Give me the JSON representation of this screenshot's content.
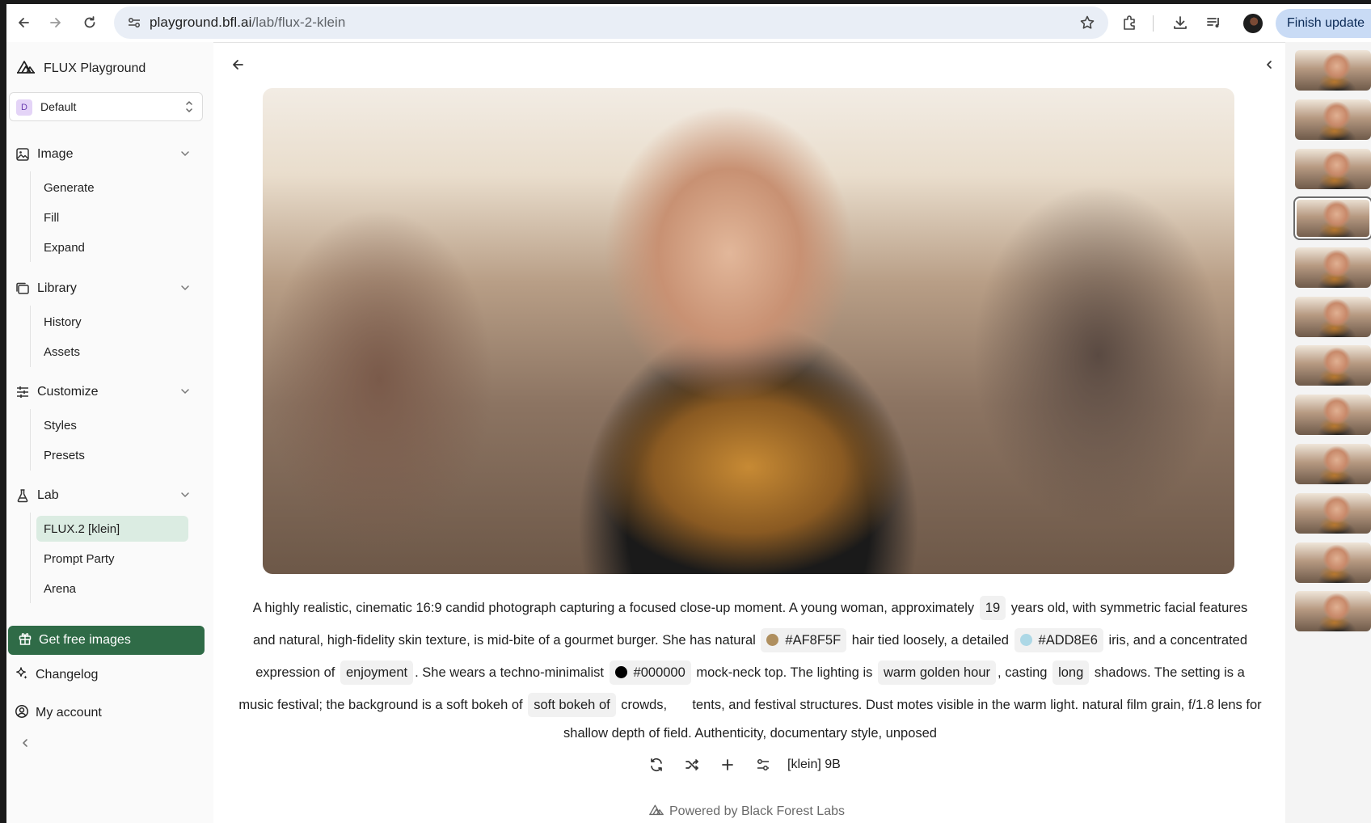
{
  "browser": {
    "url_host": "playground.bfl.ai",
    "url_path": "/lab/flux-2-klein",
    "finish_update_label": "Finish update"
  },
  "sidebar": {
    "brand": "FLUX Playground",
    "workspace": {
      "badge": "D",
      "name": "Default"
    },
    "sections": [
      {
        "label": "Image",
        "items": [
          "Generate",
          "Fill",
          "Expand"
        ]
      },
      {
        "label": "Library",
        "items": [
          "History",
          "Assets"
        ]
      },
      {
        "label": "Customize",
        "items": [
          "Styles",
          "Presets"
        ]
      },
      {
        "label": "Lab",
        "items": [
          "FLUX.2 [klein]",
          "Prompt Party",
          "Arena"
        ],
        "active_item": "FLUX.2 [klein]"
      }
    ],
    "get_free_images": "Get free images",
    "changelog": "Changelog",
    "my_account": "My account"
  },
  "prompt": {
    "line1_a": "A highly realistic, cinematic 16:9 candid photograph capturing a focused close-up moment. A young woman, approximately",
    "age": "19",
    "line1_b": "years old, with symmetric facial features",
    "line2_a": "and natural, high-fidelity skin texture, is mid-bite of a gourmet burger. She has natural",
    "hair_color": "#AF8F5F",
    "line2_b": "hair tied loosely, a detailed",
    "iris_color": "#ADD8E6",
    "line2_c": "iris, and a concentrated",
    "line3_a": "expression of",
    "expression": "enjoyment",
    "line3_b": ". She wears a techno-minimalist",
    "top_color": "#000000",
    "line3_c": "mock-neck top. The lighting is",
    "lighting": "warm golden hour",
    "line3_d": ", casting",
    "shadow_length": "long",
    "line3_e": "shadows. The setting is a",
    "line4_a": "music festival; the background is a soft bokeh of",
    "bokeh": "soft bokeh of",
    "line4_b": "crowds,",
    "blank_chip": "",
    "line4_c": "tents, and festival structures. Dust motes visible in the warm light. natural film grain, f/1.8 lens for",
    "line5": "shallow depth of field. Authenticity, documentary style, unposed"
  },
  "actions": {
    "model": "[klein] 9B"
  },
  "footer": {
    "powered_by": "Powered by Black Forest Labs"
  },
  "thumbnails": {
    "count": 12,
    "selected_index": 3
  }
}
